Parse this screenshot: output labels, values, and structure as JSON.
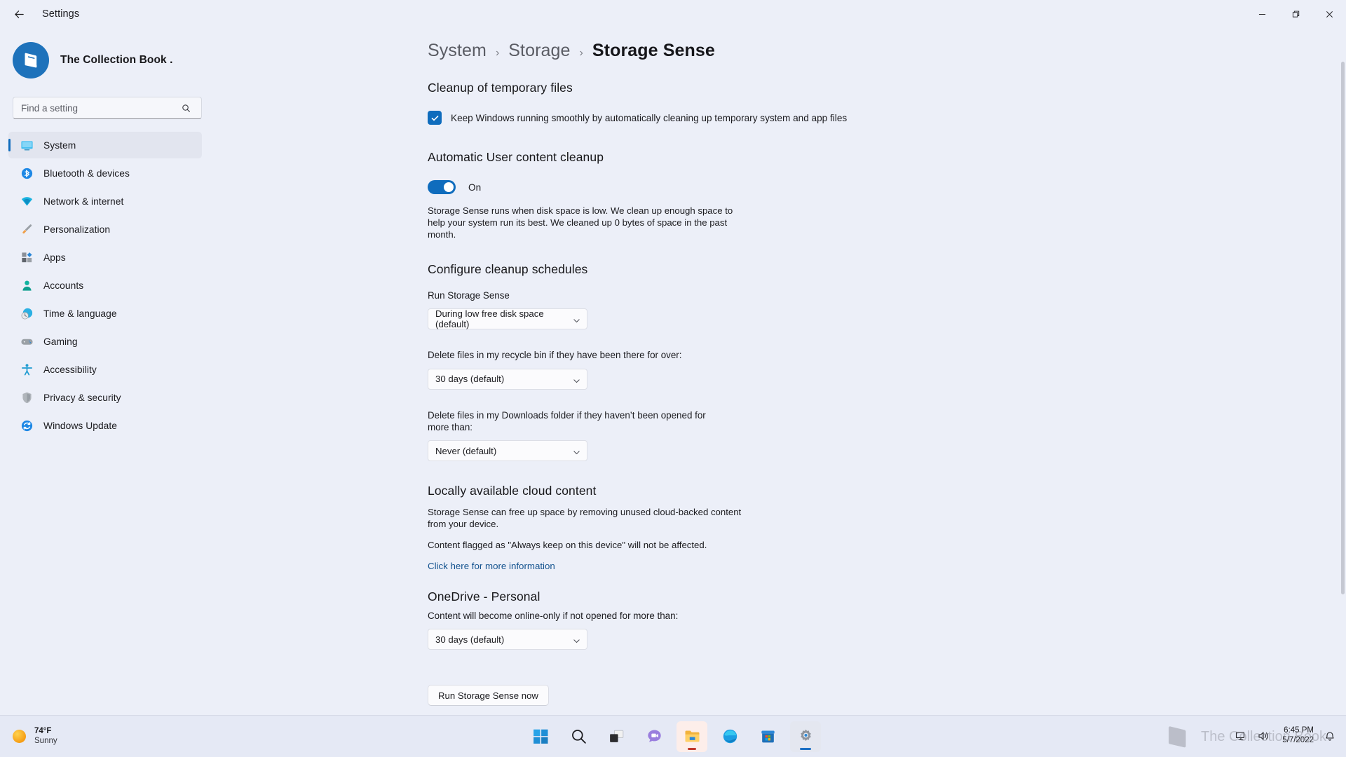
{
  "titlebar": {
    "back_label": "back-arrow",
    "title": "Settings",
    "minimize": "minimize",
    "maximize": "maximize",
    "close": "close"
  },
  "sidebar": {
    "profile_name": "The Collection Book .",
    "search_placeholder": "Find a setting",
    "search_value": "",
    "items": [
      {
        "label": "System",
        "icon": "monitor-icon",
        "active": true
      },
      {
        "label": "Bluetooth & devices",
        "icon": "bluetooth-icon",
        "active": false
      },
      {
        "label": "Network & internet",
        "icon": "wifi-icon",
        "active": false
      },
      {
        "label": "Personalization",
        "icon": "paintbrush-icon",
        "active": false
      },
      {
        "label": "Apps",
        "icon": "apps-icon",
        "active": false
      },
      {
        "label": "Accounts",
        "icon": "person-icon",
        "active": false
      },
      {
        "label": "Time & language",
        "icon": "clock-globe-icon",
        "active": false
      },
      {
        "label": "Gaming",
        "icon": "gamepad-icon",
        "active": false
      },
      {
        "label": "Accessibility",
        "icon": "accessibility-icon",
        "active": false
      },
      {
        "label": "Privacy & security",
        "icon": "shield-icon",
        "active": false
      },
      {
        "label": "Windows Update",
        "icon": "update-icon",
        "active": false
      }
    ]
  },
  "breadcrumb": {
    "segments": [
      "System",
      "Storage",
      "Storage Sense"
    ],
    "separator": "›"
  },
  "main": {
    "cleanup": {
      "heading": "Cleanup of temporary files",
      "checkbox_label": "Keep Windows running smoothly by automatically cleaning up temporary system and app files",
      "checked": true
    },
    "auto_cleanup": {
      "heading": "Automatic User content cleanup",
      "toggle_state": "On",
      "toggle_on": true,
      "description": "Storage Sense runs when disk space is low. We clean up enough space to help your system run its best. We cleaned up 0 bytes of space in the past month."
    },
    "schedules": {
      "heading": "Configure cleanup schedules",
      "run_label": "Run Storage Sense",
      "run_value": "During low free disk space (default)",
      "recycle_label": "Delete files in my recycle bin if they have been there for over:",
      "recycle_value": "30 days (default)",
      "downloads_label": "Delete files in my Downloads folder if they haven’t been opened for more than:",
      "downloads_value": "Never (default)"
    },
    "cloud": {
      "heading": "Locally available cloud content",
      "paragraph1": "Storage Sense can free up space by removing unused cloud-backed content from your device.",
      "paragraph2": "Content flagged as \"Always keep on this device\" will not be affected.",
      "link_text": "Click here for more information"
    },
    "onedrive": {
      "heading": "OneDrive - Personal",
      "label": "Content will become online-only if not opened for more than:",
      "value": "30 days (default)"
    },
    "run_button": "Run Storage Sense now"
  },
  "taskbar": {
    "weather_temp": "74°F",
    "weather_condition": "Sunny",
    "items": [
      {
        "name": "start-icon",
        "label": "Start"
      },
      {
        "name": "search-icon",
        "label": "Search"
      },
      {
        "name": "task-view-icon",
        "label": "Task View"
      },
      {
        "name": "chat-icon",
        "label": "Chat"
      },
      {
        "name": "file-explorer-icon",
        "label": "File Explorer"
      },
      {
        "name": "edge-icon",
        "label": "Microsoft Edge"
      },
      {
        "name": "store-icon",
        "label": "Microsoft Store"
      },
      {
        "name": "settings-icon",
        "label": "Settings"
      }
    ],
    "tray": {
      "network_icon": "network-icon",
      "volume_icon": "volume-icon",
      "notification_icon": "notification-icon",
      "time": "6:45 PM",
      "date": "5/7/2022"
    },
    "watermark_text": "The Collection Book"
  },
  "colors": {
    "accent": "#0f6cbd",
    "background": "#eceff8",
    "taskbar": "#e5e9f5",
    "link": "#14538f"
  }
}
